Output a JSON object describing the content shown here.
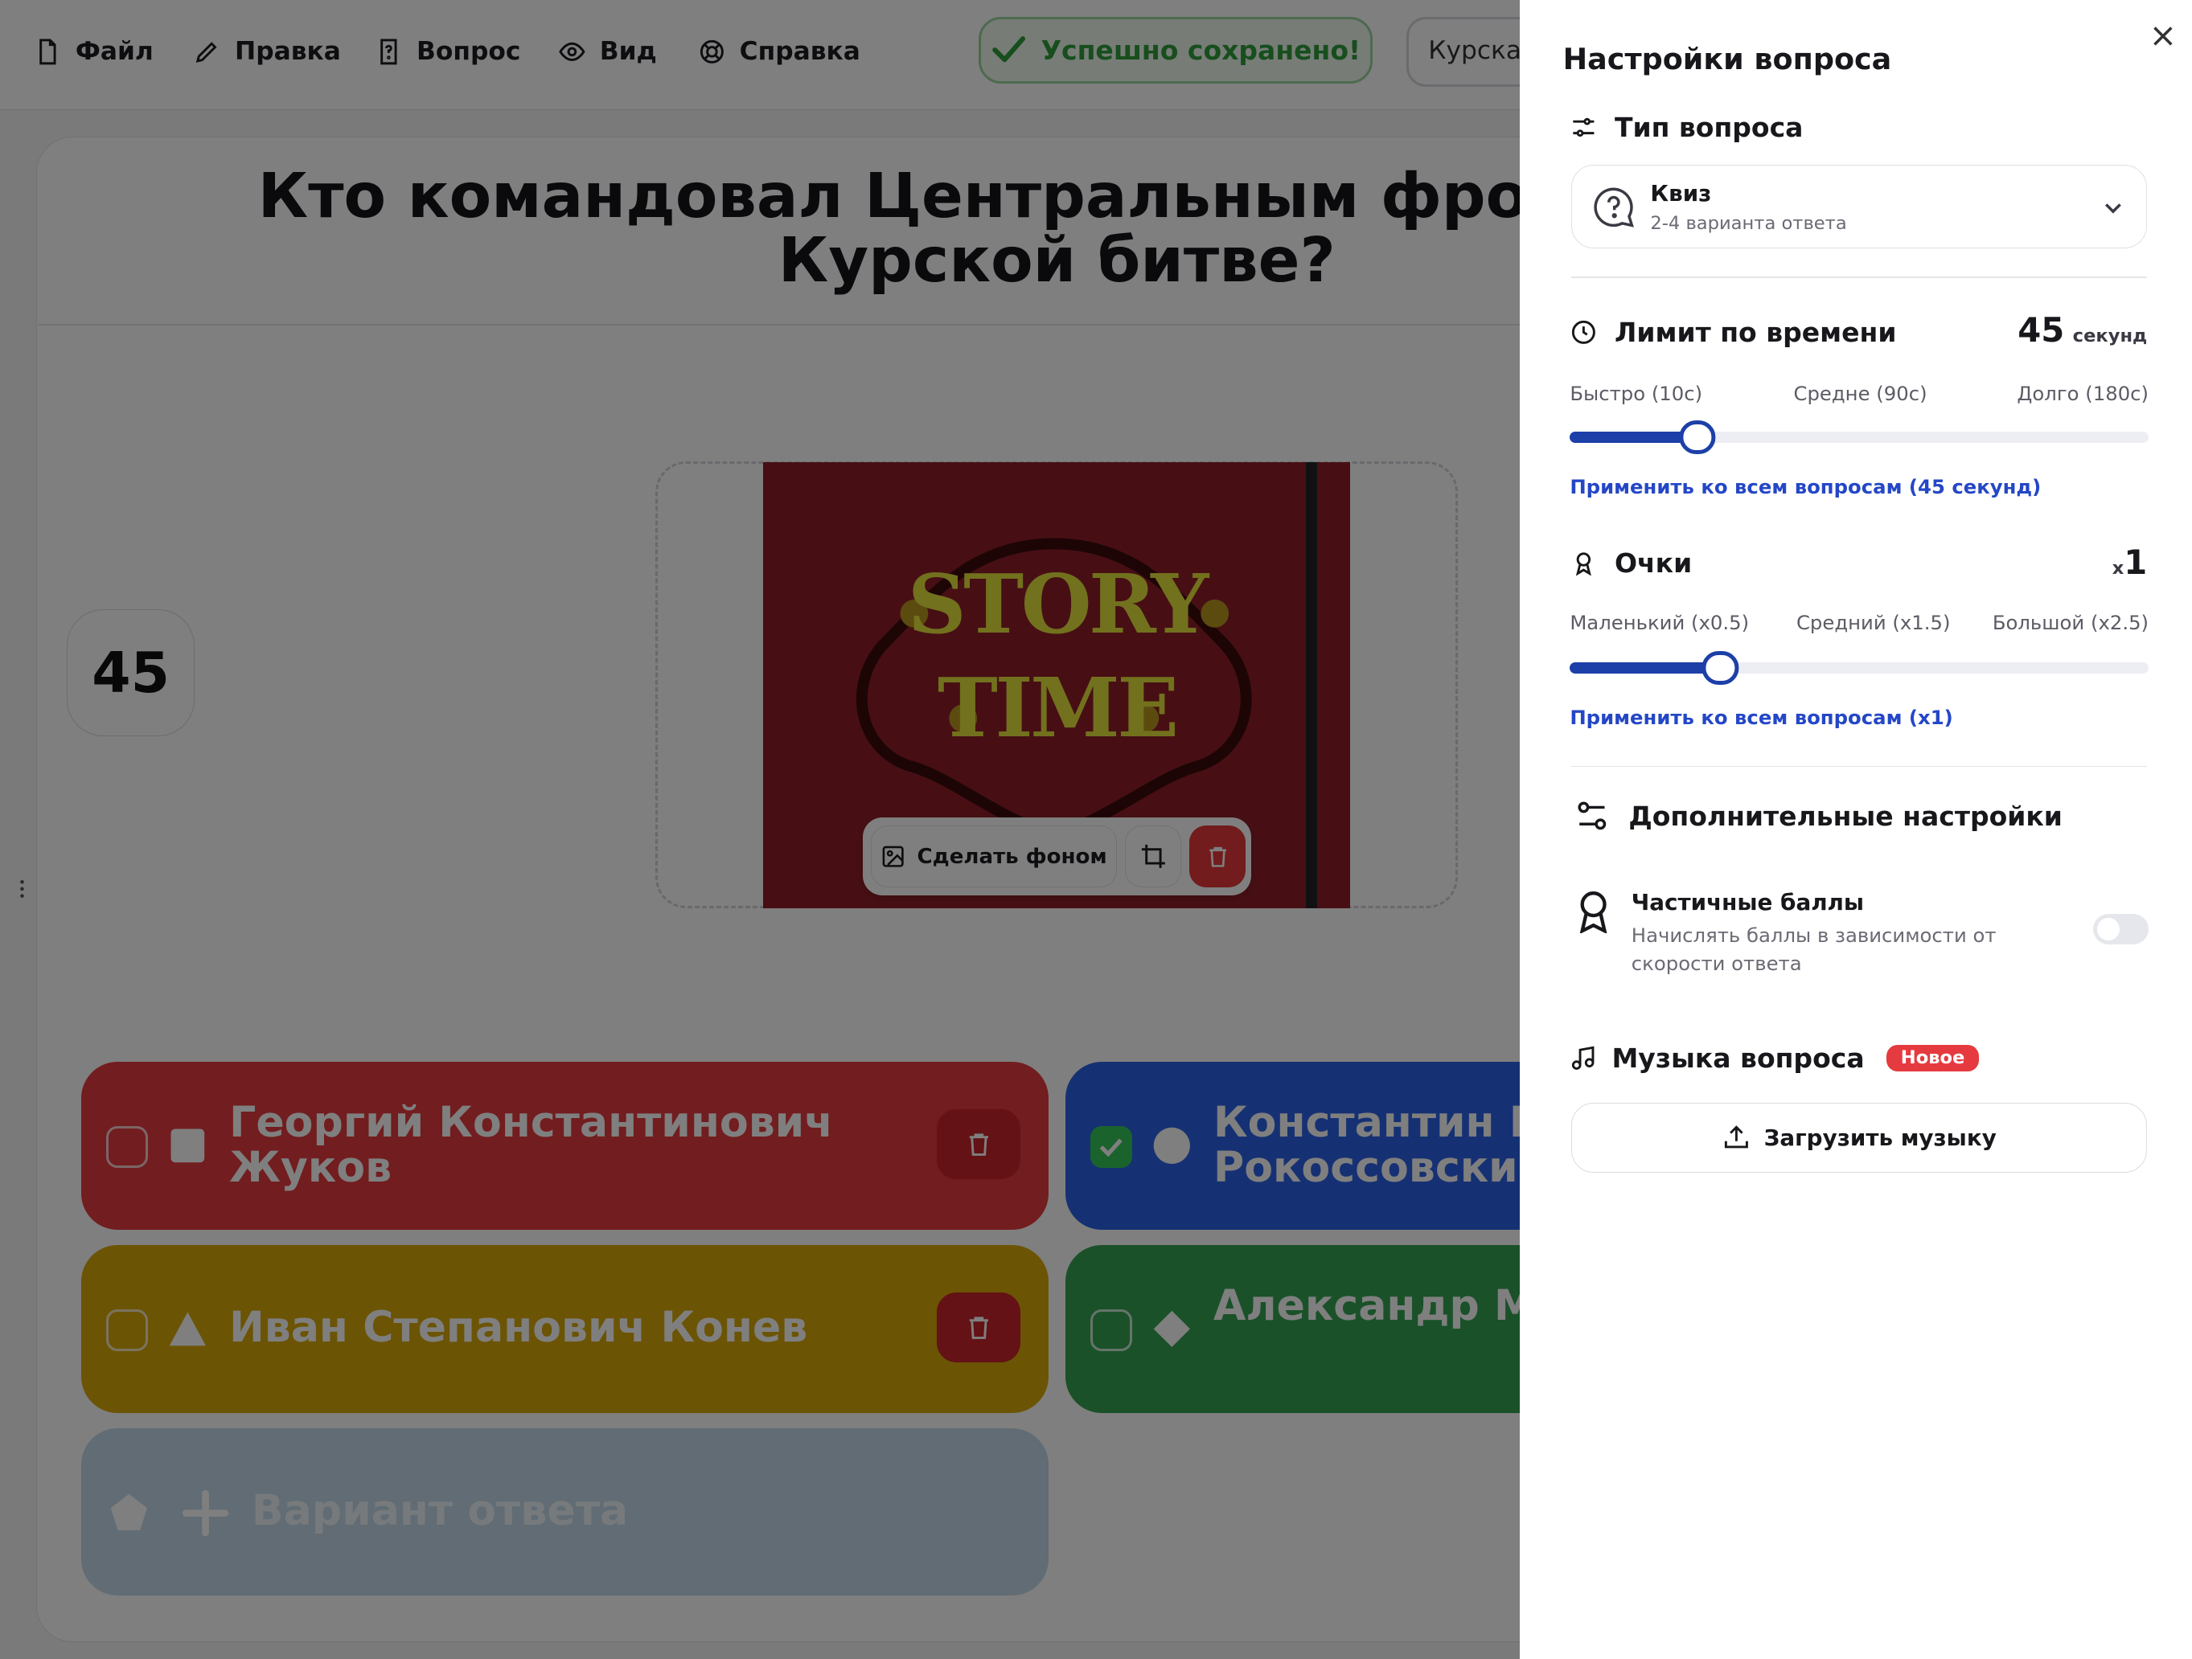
{
  "menu": [
    {
      "label": "Файл",
      "icon": "file-icon"
    },
    {
      "label": "Правка",
      "icon": "pencil-icon"
    },
    {
      "label": "Вопрос",
      "icon": "question-file-icon"
    },
    {
      "label": "Вид",
      "icon": "eye-icon"
    },
    {
      "label": "Справка",
      "icon": "lifebuoy-icon"
    }
  ],
  "status": {
    "saved_text": "Успешно сохранено!",
    "color": "#2e9d3a"
  },
  "quiz_title_value": "Курская",
  "question": {
    "text": "Кто командовал Центральным фронтом Красной Армии в Курской битве?",
    "visible_line1": "Кто командовал Центральным фронтом Кра",
    "visible_line2": "Курской битве?",
    "timer": "45"
  },
  "media": {
    "image_text_line1": "STORY",
    "image_text_line2": "TIME",
    "make_background_label": "Сделать фоном"
  },
  "answers": [
    {
      "text": "Георгий Константинович Жуков",
      "shape": "square",
      "color": "#e53a3f",
      "correct": false
    },
    {
      "text": "Константин Ко Рокоссовский",
      "shape": "circle",
      "color": "#2c62e6",
      "correct": true
    },
    {
      "text": "Иван Степанович Конев",
      "shape": "triangle",
      "color": "#d8a90a",
      "correct": false
    },
    {
      "text": "Александр Ми Василевский",
      "shape": "diamond",
      "color": "#34a353",
      "correct": false
    }
  ],
  "add_answer": {
    "placeholder": "Вариант ответа",
    "shape": "pentagon"
  },
  "panel": {
    "title": "Настройки вопроса",
    "type_section": {
      "label": "Тип вопроса",
      "selected_name": "Квиз",
      "selected_sub": "2-4 варианта ответа"
    },
    "time_limit": {
      "label": "Лимит по времени",
      "value": "45",
      "unit": "секунд",
      "ticks": [
        "Быстро (10с)",
        "Средне (90с)",
        "Долго (180с)"
      ],
      "slider_fraction": 0.22,
      "apply_link": "Применить ко всем вопросам (45 секунд)"
    },
    "points": {
      "label": "Очки",
      "prefix": "x",
      "value": "1",
      "ticks": [
        "Маленький (x0.5)",
        "Средний (x1.5)",
        "Большой (x2.5)"
      ],
      "slider_fraction": 0.26,
      "apply_link": "Применить ко всем вопросам (x1)"
    },
    "advanced": {
      "title": "Дополнительные настройки",
      "partial_title": "Частичные баллы",
      "partial_desc": "Начислять баллы в зависимости от скорости ответа",
      "partial_enabled": false
    },
    "music": {
      "title": "Музыка вопроса",
      "badge": "Новое",
      "upload_label": "Загрузить музыку"
    }
  },
  "colors": {
    "accent": "#1d3fa8",
    "link": "#2447c7",
    "danger": "#e53a3f"
  }
}
